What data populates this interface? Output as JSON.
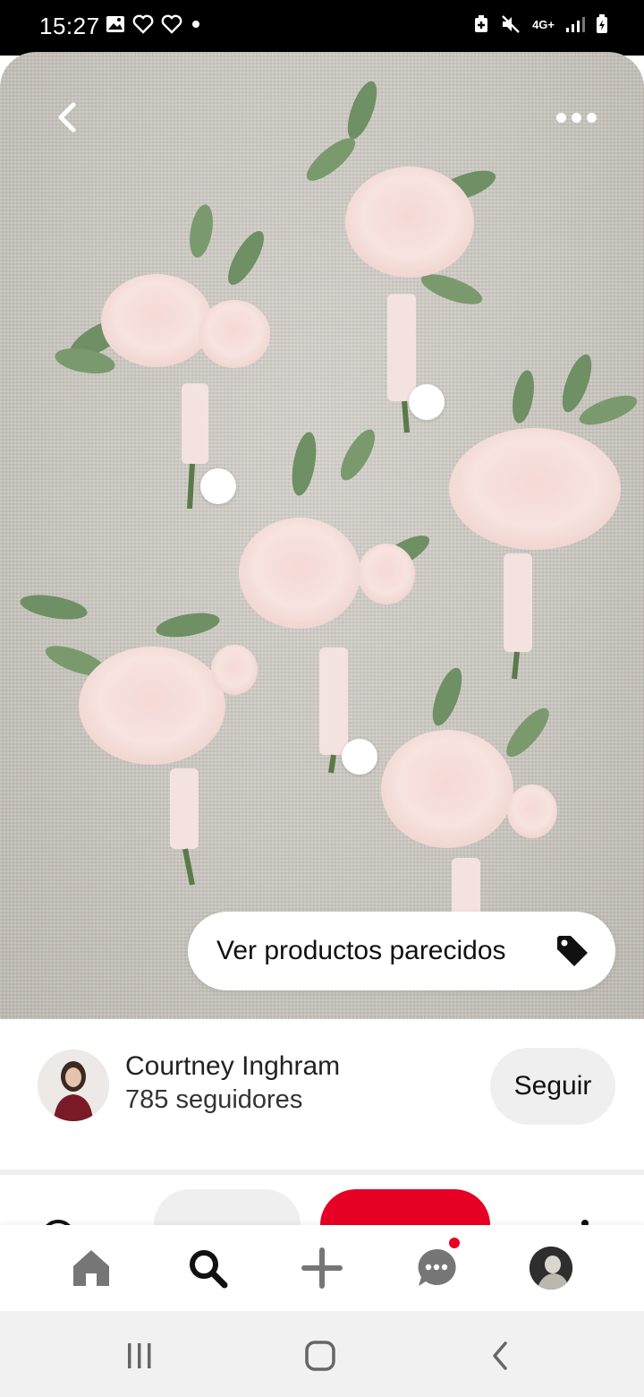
{
  "status_bar": {
    "time": "15:27",
    "left_icons": [
      "image-icon",
      "heart-outline-icon",
      "heart-outline-icon",
      "dot-icon"
    ],
    "right_icons": [
      "alarm-icon",
      "mute-icon",
      "network-4g-icon",
      "signal-icon",
      "battery-charging-icon"
    ],
    "network_label": "4G+"
  },
  "pin": {
    "image_description_icon": "boutonniere-photo",
    "hotspot_count": 4,
    "similar_products_label": "Ver productos parecidos",
    "tag_icon": "tag-icon"
  },
  "creator": {
    "name": "Courtney Inghram",
    "followers": "785 seguidores",
    "follow_label": "Seguir"
  },
  "bottom_nav": {
    "items": [
      "home-icon",
      "search-icon",
      "add-icon",
      "messages-icon",
      "profile-avatar"
    ],
    "notification": true
  },
  "system_nav": [
    "recent-apps-icon",
    "home-button-icon",
    "back-icon"
  ],
  "colors": {
    "accent": "#e60023",
    "background": "#ffffff",
    "chip": "#efefef"
  }
}
